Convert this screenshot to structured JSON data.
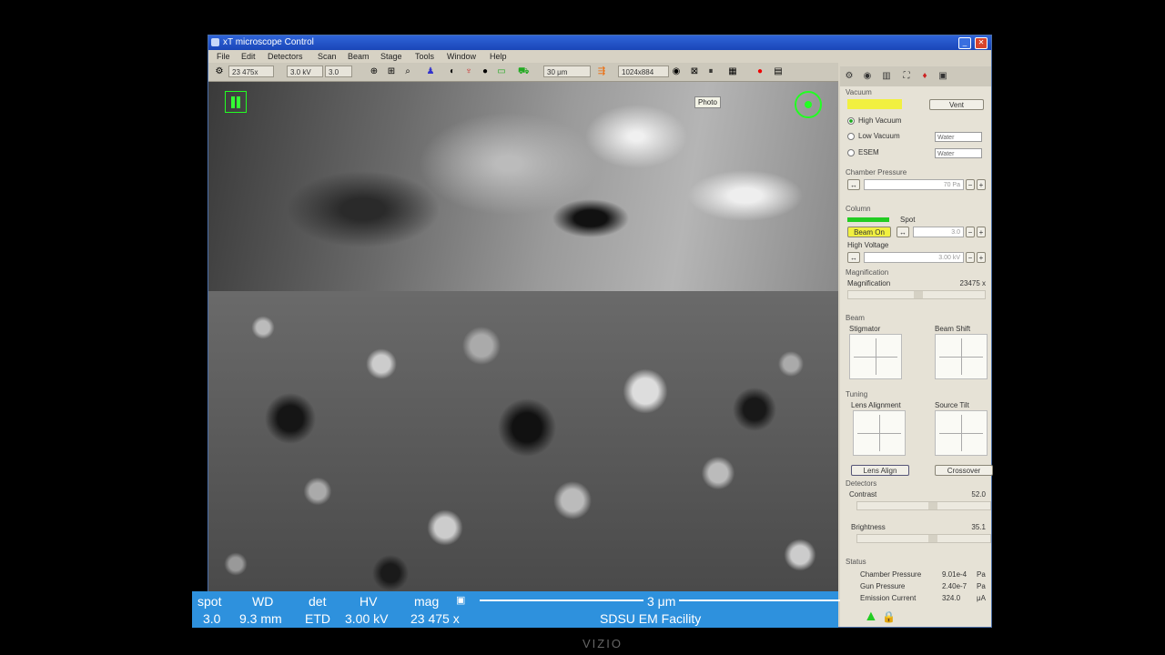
{
  "window": {
    "title": "xT microscope Control"
  },
  "menu": [
    "File",
    "Edit",
    "Detectors",
    "Scan",
    "Beam",
    "Stage",
    "Tools",
    "Window",
    "Help"
  ],
  "toolbar": {
    "mag_value": "23 475x",
    "hv_value": "3.0 kV",
    "spot_value": "3.0",
    "hfw_value": "30 μm",
    "resolution": "1024x884"
  },
  "image": {
    "photo_label": "Photo"
  },
  "databar": {
    "spot_label": "spot",
    "spot_value": "3.0",
    "wd_label": "WD",
    "wd_value": "9.3 mm",
    "det_label": "det",
    "det_value": "ETD",
    "hv_label": "HV",
    "hv_value": "3.00 kV",
    "mag_label": "mag",
    "mag_value": "23 475 x",
    "scale_label": "3 μm",
    "facility": "SDSU EM Facility"
  },
  "panel": {
    "vacuum": {
      "title": "Vacuum",
      "vent_button": "Vent",
      "high_vacuum": "High Vacuum",
      "low_vacuum": "Low Vacuum",
      "esem": "ESEM",
      "low_vac_gas": "Water",
      "esem_gas": "Water",
      "chamber_pressure_label": "Chamber Pressure",
      "chamber_pressure_value": "70 Pa",
      "status_color": "#f1f040"
    },
    "column": {
      "title": "Column",
      "spot_label": "Spot",
      "beam_on": "Beam On",
      "spot_value": "3.0",
      "hv_label": "High Voltage",
      "hv_value": "3.00 kV",
      "beam_indicator_color": "#22cc22"
    },
    "magnification": {
      "title": "Magnification",
      "label": "Magnification",
      "value": "23475 x"
    },
    "beam": {
      "title": "Beam",
      "stigmator": "Stigmator",
      "beam_shift": "Beam Shift"
    },
    "tuning": {
      "title": "Tuning",
      "lens_alignment": "Lens Alignment",
      "source_tilt": "Source Tilt",
      "lens_align_button": "Lens Align",
      "crossover_button": "Crossover"
    },
    "detectors": {
      "title": "Detectors",
      "contrast_label": "Contrast",
      "contrast_value": "52.0",
      "brightness_label": "Brightness",
      "brightness_value": "35.1"
    },
    "status": {
      "title": "Status",
      "chamber_pressure_label": "Chamber Pressure",
      "chamber_pressure_value": "9.01e-4",
      "chamber_pressure_unit": "Pa",
      "gun_pressure_label": "Gun Pressure",
      "gun_pressure_value": "2.40e-7",
      "gun_pressure_unit": "Pa",
      "emission_current_label": "Emission Current",
      "emission_current_value": "324.0",
      "emission_current_unit": "μA"
    }
  },
  "monitor_brand": "VIZIO",
  "colors": {
    "accent_green": "#33ff33",
    "databar_blue": "#2e91dd",
    "title_blue": "#1a46b8"
  }
}
